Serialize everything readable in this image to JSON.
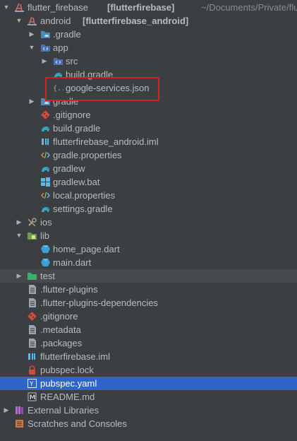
{
  "project": {
    "name": "flutter_firebase",
    "module": "[flutterfirebase]",
    "path": "~/Documents/Private/flutter_firebase"
  },
  "android": {
    "name": "android",
    "module": "[flutterfirebase_android]"
  },
  "items": {
    "gradle_dir": ".gradle",
    "app": "app",
    "src": "src",
    "app_build_gradle": "build.gradle",
    "google_services": "google-services.json",
    "gradle": "gradle",
    "gitignore_android": ".gitignore",
    "build_gradle": "build.gradle",
    "iml_android": "flutterfirebase_android.iml",
    "gradle_properties": "gradle.properties",
    "gradlew": "gradlew",
    "gradlew_bat": "gradlew.bat",
    "local_properties": "local.properties",
    "settings_gradle": "settings.gradle",
    "ios": "ios",
    "lib": "lib",
    "home_page": "home_page.dart",
    "main_dart": "main.dart",
    "test": "test",
    "flutter_plugins": ".flutter-plugins",
    "flutter_plugins_deps": ".flutter-plugins-dependencies",
    "gitignore": ".gitignore",
    "metadata": ".metadata",
    "packages": ".packages",
    "iml": "flutterfirebase.iml",
    "pubspec_lock": "pubspec.lock",
    "pubspec_yaml": "pubspec.yaml",
    "readme": "README.md",
    "external_libraries": "External Libraries",
    "scratches": "Scratches and Consoles"
  },
  "colors": {
    "background": "#3c3f41",
    "selection": "#2f65ca",
    "highlight_box": "#d0212b",
    "folder": "#4d8ab5",
    "gradle": "#39a3c3",
    "flutter": "#5fb8e8"
  }
}
